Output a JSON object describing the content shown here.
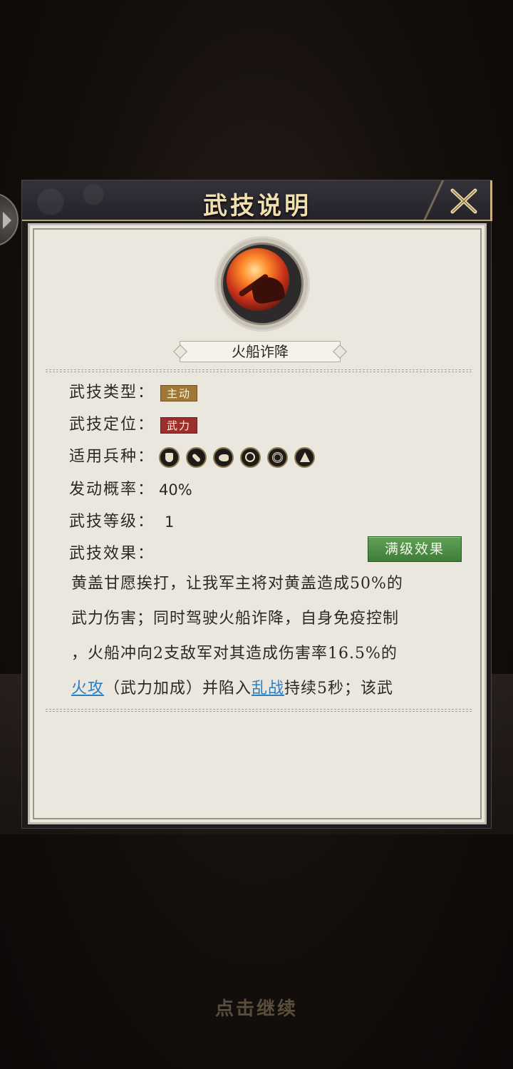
{
  "dialog": {
    "title": "武技说明",
    "skill_name": "火船诈降",
    "fields": {
      "type_label": "武技类型：",
      "type_value": "主动",
      "position_label": "武技定位：",
      "position_value": "武力",
      "units_label": "适用兵种：",
      "units": [
        "shield-unit-icon",
        "spear-unit-icon",
        "cavalry-unit-icon",
        "bow-unit-icon",
        "wheel-unit-icon",
        "ship-unit-icon"
      ],
      "chance_label": "发动概率：",
      "chance_value": "40%",
      "level_label": "武技等级：",
      "level_value": "1",
      "effect_label": "武技效果："
    },
    "max_level_button": "满级效果",
    "description": {
      "line1": "黄盖甘愿挨打，让我军主将对黄盖造成50%的",
      "line2": "武力伤害；同时驾驶火船诈降，自身免疫控制",
      "line3": "，火船冲向2支敌军对其造成伤害率16.5%的",
      "line4_link1": "火攻",
      "line4_mid": "（武力加成）并陷入",
      "line4_link2": "乱战",
      "line4_end": "持续5秒；该武"
    }
  },
  "footer": {
    "continue_text": "点击继续"
  },
  "colors": {
    "accent_gold": "#a07734",
    "accent_red": "#9c2e2e",
    "button_green": "#4f8f47",
    "link_blue": "#2b7fc2",
    "title_gold": "#f1dfae"
  }
}
